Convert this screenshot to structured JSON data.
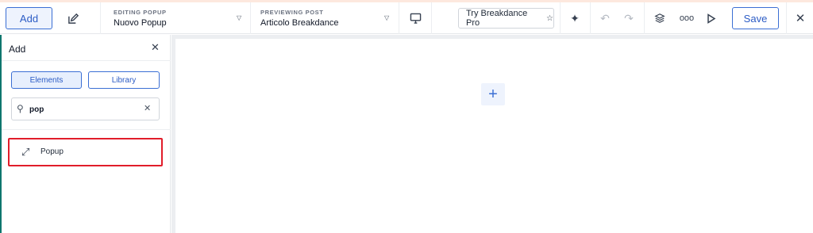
{
  "colors": {
    "accent": "#3b6fd4",
    "highlight": "#e11d2a",
    "topline": "#fde8de"
  },
  "toolbar": {
    "add_label": "Add",
    "editing": {
      "caption": "EDITING POPUP",
      "value": "Nuovo Popup"
    },
    "previewing": {
      "caption": "PREVIEWING POST",
      "value": "Articolo Breakdance"
    },
    "try_label": "Try Breakdance Pro",
    "save_label": "Save",
    "icons": [
      "edit-icon",
      "caret-down-icon",
      "desktop-icon",
      "sparkle-icon",
      "undo-icon",
      "redo-icon",
      "layers-icon",
      "more-icon",
      "play-icon",
      "close-icon"
    ]
  },
  "sidebar": {
    "title": "Add",
    "tabs": [
      {
        "label": "Elements",
        "active": true
      },
      {
        "label": "Library",
        "active": false
      }
    ],
    "search": {
      "value": "pop",
      "placeholder": ""
    },
    "results": [
      {
        "label": "Popup",
        "icon": "expand-arrows-icon"
      }
    ]
  },
  "canvas": {
    "add_icon": "plus-icon"
  }
}
